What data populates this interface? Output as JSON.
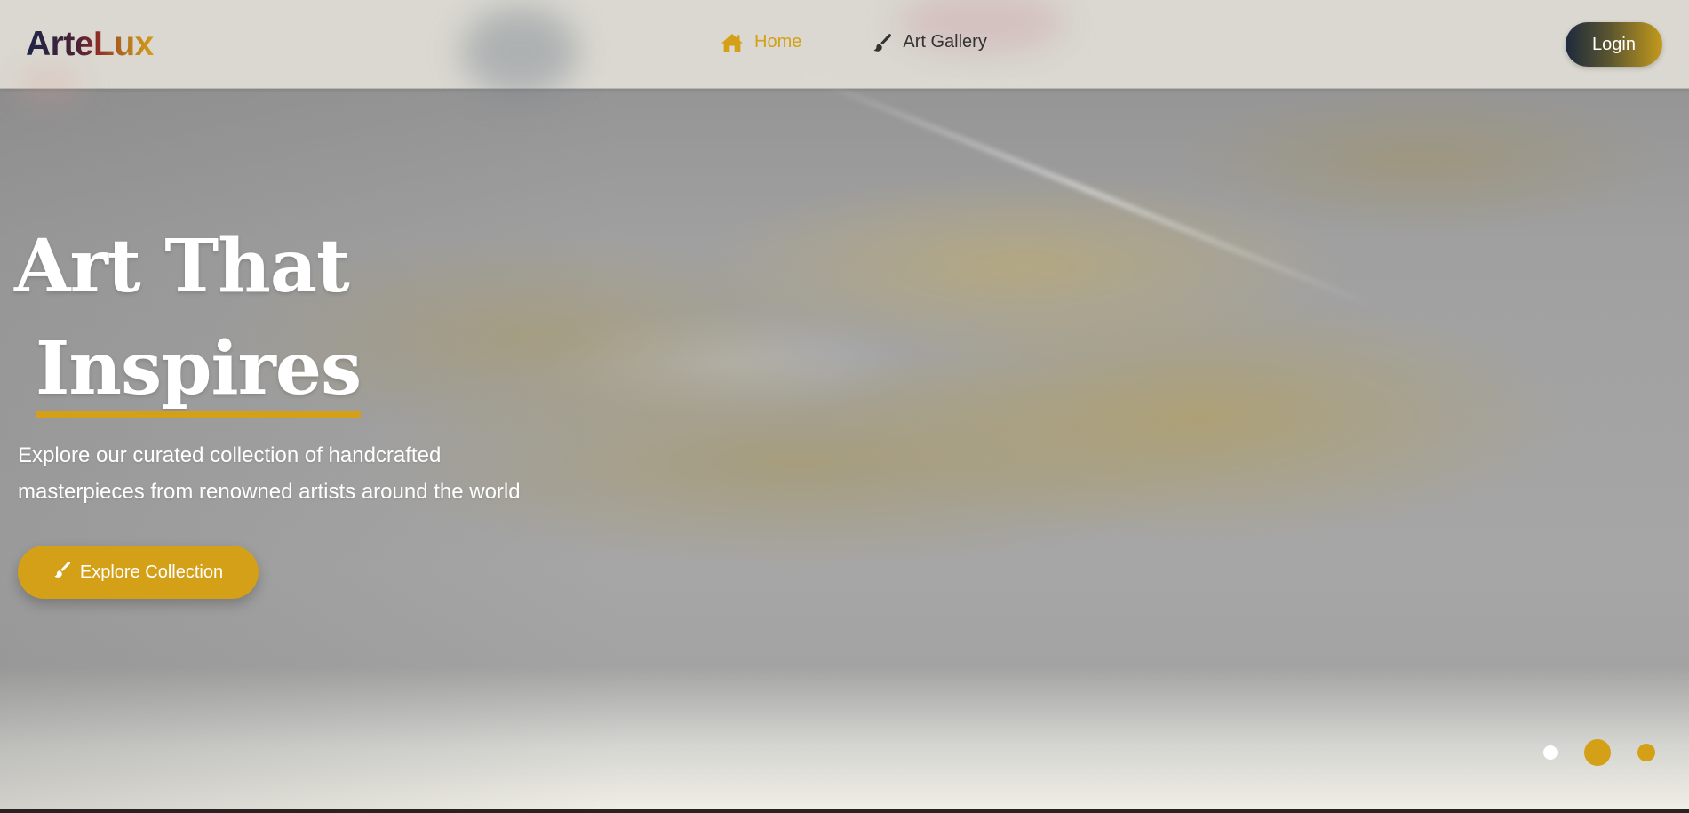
{
  "header": {
    "logo": "ArteLux",
    "nav": [
      {
        "label": "Home",
        "icon": "home-icon",
        "active": true
      },
      {
        "label": "Art Gallery",
        "icon": "paintbrush-icon",
        "active": false
      }
    ],
    "login_label": "Login"
  },
  "hero": {
    "title_line1": "Art That",
    "title_line2": "Inspires",
    "subtitle_line1": "Explore our curated collection of handcrafted",
    "subtitle_line2": "masterpieces from renowned artists around the world",
    "cta_label": "Explore Collection",
    "cta_icon": "paintbrush-icon"
  },
  "carousel": {
    "slide_count": 3,
    "active_index": 1
  },
  "colors": {
    "accent": "#d4a017",
    "text_dark": "#333333",
    "navy": "#1d2447"
  }
}
